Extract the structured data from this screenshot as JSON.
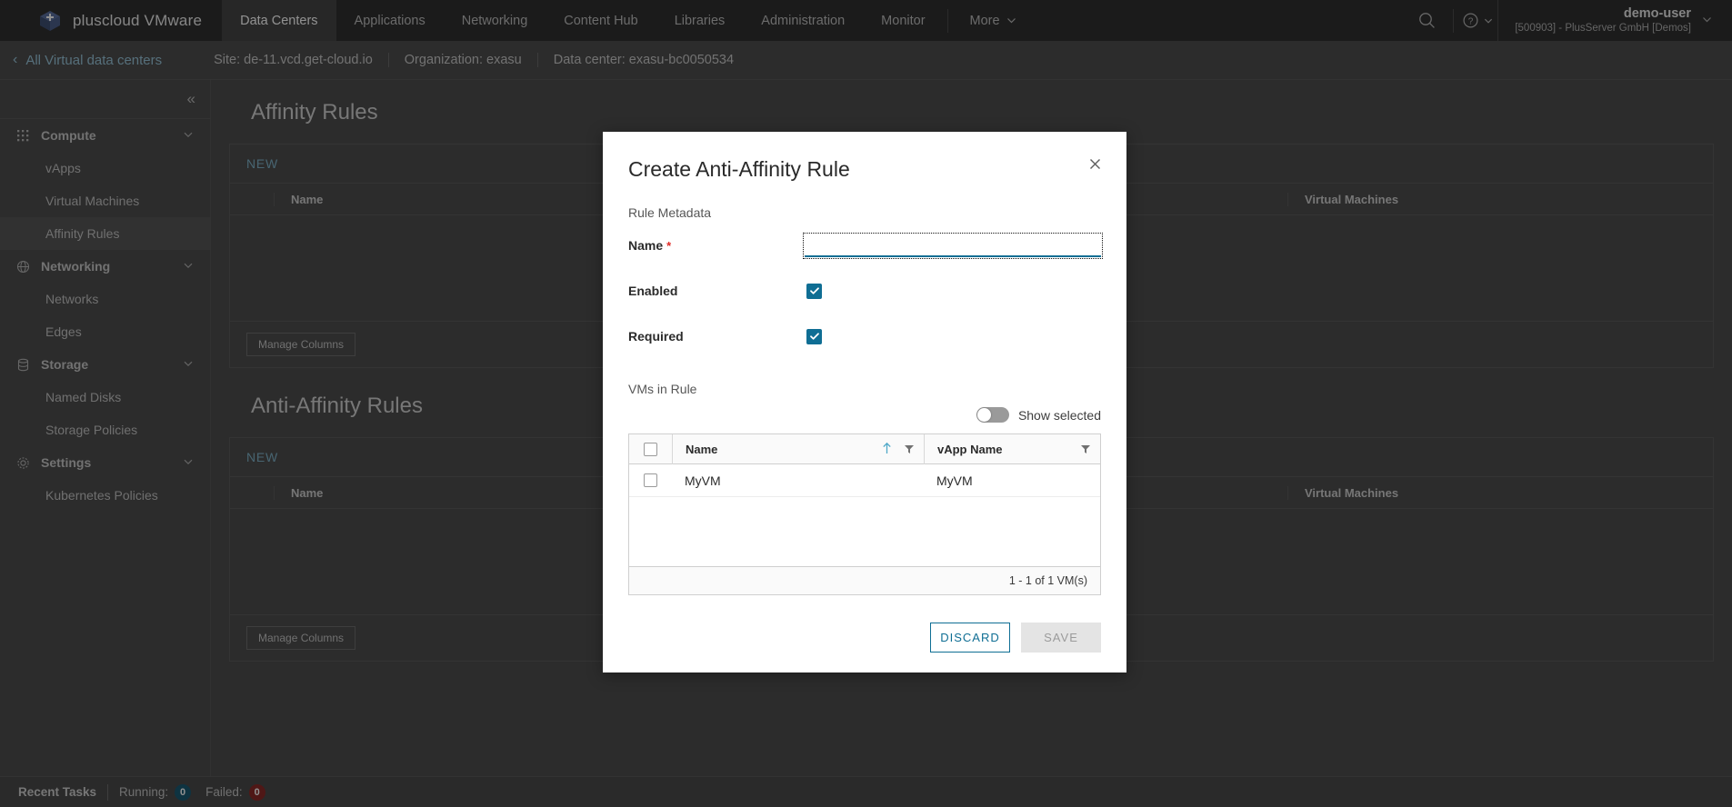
{
  "header": {
    "brand": "pluscloud VMware",
    "logo_icon": "plus-cloud-logo-icon",
    "nav": [
      {
        "label": "Data Centers",
        "active": true
      },
      {
        "label": "Applications",
        "active": false
      },
      {
        "label": "Networking",
        "active": false
      },
      {
        "label": "Content Hub",
        "active": false
      },
      {
        "label": "Libraries",
        "active": false
      },
      {
        "label": "Administration",
        "active": false
      },
      {
        "label": "Monitor",
        "active": false
      }
    ],
    "more_label": "More",
    "search_icon": "search-icon",
    "help_icon": "help-circle-icon",
    "user_name": "demo-user",
    "user_org": "[500903] - PlusServer GmbH [Demos]"
  },
  "breadcrumb": {
    "back_label": "All Virtual data centers",
    "back_icon": "chevron-left-icon",
    "site": "Site: de-11.vcd.get-cloud.io",
    "organization": "Organization: exasu",
    "datacenter": "Data center: exasu-bc0050534"
  },
  "sidebar": {
    "collapse_icon": "double-chevron-left-icon",
    "groups": [
      {
        "label": "Compute",
        "icon": "grid-icon",
        "chevron": "chevron-down-icon",
        "children": [
          {
            "label": "vApps",
            "selected": false
          },
          {
            "label": "Virtual Machines",
            "selected": false
          },
          {
            "label": "Affinity Rules",
            "selected": true
          }
        ]
      },
      {
        "label": "Networking",
        "icon": "network-globe-icon",
        "chevron": "chevron-down-icon",
        "children": [
          {
            "label": "Networks",
            "selected": false
          },
          {
            "label": "Edges",
            "selected": false
          }
        ]
      },
      {
        "label": "Storage",
        "icon": "database-icon",
        "chevron": "chevron-down-icon",
        "children": [
          {
            "label": "Named Disks",
            "selected": false
          },
          {
            "label": "Storage Policies",
            "selected": false
          }
        ]
      },
      {
        "label": "Settings",
        "icon": "cog-icon",
        "chevron": "chevron-down-icon",
        "children": [
          {
            "label": "Kubernetes Policies",
            "selected": false
          }
        ]
      }
    ]
  },
  "main": {
    "affinity": {
      "title": "Affinity Rules",
      "new_label": "NEW",
      "columns": [
        "Name",
        "Virtual Machines"
      ],
      "rows": [],
      "manage_columns_label": "Manage Columns"
    },
    "anti_affinity": {
      "title": "Anti-Affinity Rules",
      "new_label": "NEW",
      "columns": [
        "Name",
        "Virtual Machines"
      ],
      "rows": [],
      "manage_columns_label": "Manage Columns"
    }
  },
  "modal": {
    "title": "Create Anti-Affinity Rule",
    "close_icon": "close-icon",
    "section_metadata": "Rule Metadata",
    "name_label": "Name",
    "name_required_mark": "*",
    "name_value": "",
    "enabled_label": "Enabled",
    "enabled_checked": true,
    "required_label": "Required",
    "required_checked": true,
    "vms_section_label": "VMs in Rule",
    "show_selected_label": "Show selected",
    "show_selected_on": false,
    "table": {
      "columns": [
        {
          "label": "Name",
          "sort": "asc",
          "sort_icon": "arrow-up-icon",
          "filter_icon": "filter-icon"
        },
        {
          "label": "vApp Name",
          "sort": "none",
          "filter_icon": "filter-icon"
        }
      ],
      "rows": [
        {
          "selected": false,
          "name": "MyVM",
          "vapp_name": "MyVM"
        }
      ],
      "footer": "1 - 1 of 1 VM(s)"
    },
    "discard_label": "DISCARD",
    "save_label": "SAVE",
    "save_disabled": true
  },
  "statusbar": {
    "title": "Recent Tasks",
    "running_label": "Running:",
    "running_count": "0",
    "failed_label": "Failed:",
    "failed_count": "0"
  },
  "colors": {
    "accent_blue": "#0f6e94",
    "header_bg": "#313131",
    "panel_bg": "#4e4e4e",
    "running_badge": "#1a5a73",
    "failed_badge": "#8b2a27"
  }
}
